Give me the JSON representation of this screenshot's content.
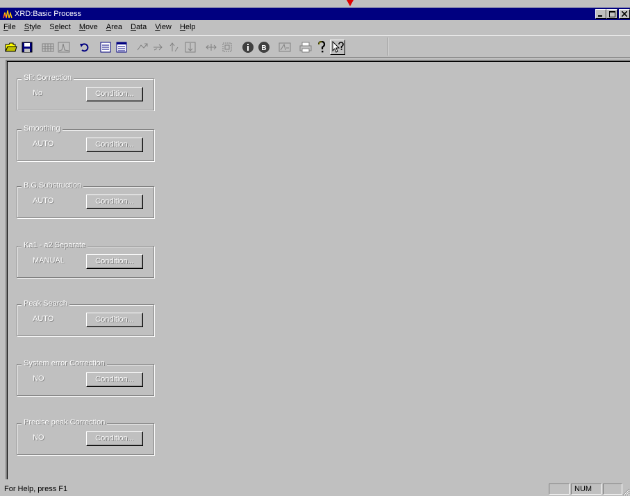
{
  "window": {
    "title": "XRD:Basic Process",
    "controls": [
      "minimize",
      "maximize",
      "close"
    ]
  },
  "menu": [
    {
      "label": "File",
      "accel": "F"
    },
    {
      "label": "Style",
      "accel": "S"
    },
    {
      "label": "Select",
      "accel": "e"
    },
    {
      "label": "Move",
      "accel": "M"
    },
    {
      "label": "Area",
      "accel": "A"
    },
    {
      "label": "Data",
      "accel": "D"
    },
    {
      "label": "View",
      "accel": "V"
    },
    {
      "label": "Help",
      "accel": "H"
    }
  ],
  "toolbar": {
    "buttons": [
      "open-icon",
      "save-icon",
      "chart-grid-icon",
      "chart-peak-icon",
      "undo-icon",
      "list-icon",
      "list-alt-icon",
      "arrow-left-icon",
      "arrow-right-icon",
      "cursor-up-icon",
      "cursor-down-icon",
      "expand-icon",
      "zoom-box-icon",
      "info-icon",
      "b-circle-icon",
      "peak-icon",
      "print-icon",
      "help-icon",
      "context-help-icon"
    ]
  },
  "groups": [
    {
      "title": "Slit Correction",
      "value": "No",
      "button": "Condition..."
    },
    {
      "title": "Smoothing",
      "value": "AUTO",
      "button": "Condition..."
    },
    {
      "title": "B.G.Substruction",
      "value": "AUTO",
      "button": "Condition..."
    },
    {
      "title": "Ka1 - a2 Separate",
      "value": "MANUAL",
      "button": "Condition..."
    },
    {
      "title": "Peak Search",
      "value": "AUTO",
      "button": "Condition..."
    },
    {
      "title": "System error Correction",
      "value": "NO",
      "button": "Condition..."
    },
    {
      "title": "Precise peak Correction",
      "value": "NO",
      "button": "Condition..."
    }
  ],
  "status": {
    "help": "For Help, press F1",
    "num": "NUM"
  }
}
